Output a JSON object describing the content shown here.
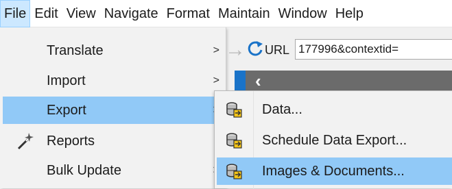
{
  "menubar": {
    "items": [
      {
        "label": "File",
        "active": true
      },
      {
        "label": "Edit"
      },
      {
        "label": "View"
      },
      {
        "label": "Navigate"
      },
      {
        "label": "Format"
      },
      {
        "label": "Maintain"
      },
      {
        "label": "Window"
      },
      {
        "label": "Help"
      }
    ]
  },
  "toolbar": {
    "url_label": "URL",
    "url_value": "177996&contextid=",
    "icons": [
      "forward-arrow-icon",
      "refresh-icon",
      "back-chevron-icon"
    ]
  },
  "file_menu": {
    "items": [
      {
        "label": "Translate",
        "has_submenu": true
      },
      {
        "label": "Import",
        "has_submenu": true
      },
      {
        "label": "Export",
        "has_submenu": true,
        "highlighted": true
      },
      {
        "label": "Reports",
        "icon": "magic-wand-icon"
      },
      {
        "label": "Bulk Update",
        "has_submenu": true
      }
    ],
    "submenu_arrow": ">"
  },
  "export_submenu": {
    "items": [
      {
        "label": "Data...",
        "icon": "database-export-icon"
      },
      {
        "label": "Schedule Data Export...",
        "icon": "database-export-icon"
      },
      {
        "label": "Images & Documents...",
        "icon": "database-export-icon",
        "highlighted": true
      }
    ]
  },
  "colors": {
    "highlight": "#91c9f7",
    "menubar_active": "#cce8ff",
    "accent_blue": "#1a73c8"
  }
}
